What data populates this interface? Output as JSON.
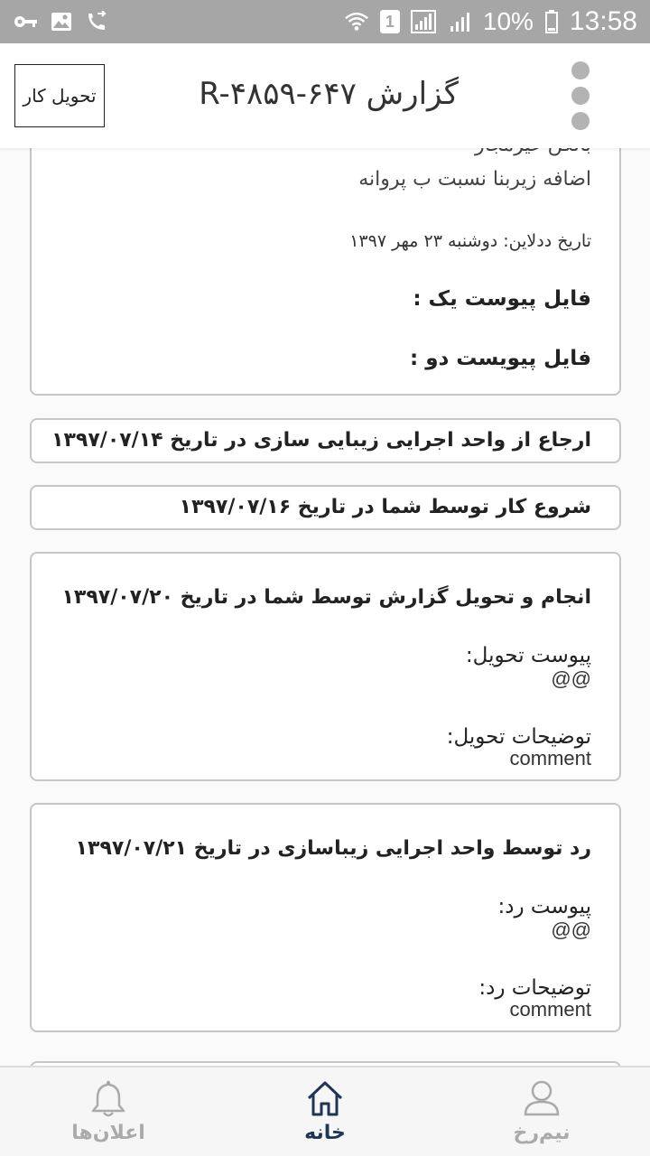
{
  "status_bar": {
    "battery_percent": "10%",
    "time": "13:58",
    "sim_number": "1"
  },
  "app_bar": {
    "title": "گزارش R-۴۸۵۹-۶۴۷",
    "deliver_button": "تحویل کار"
  },
  "details_card": {
    "line_cut": "بالکن غیرمجاز",
    "line_area": "اضافه زیربنا نسبت ب پروانه",
    "deadline": "تاریخ ددلاین: دوشنبه ۲۳ مهر ۱۳۹۷",
    "attachment_one": "فایل پیوست یک :",
    "attachment_two": "فایل پیویست دو :"
  },
  "timeline": {
    "referral": "ارجاع از واحد اجرایی زیبایی سازی در تاریخ ۱۳۹۷/۰۷/۱۴",
    "start": "شروع کار توسط شما در تاریخ ۱۳۹۷/۰۷/۱۶",
    "delivery": {
      "title": "انجام و تحویل گزارش توسط شما در تاریخ ۱۳۹۷/۰۷/۲۰",
      "attachment_label": "پیوست تحویل:",
      "attachment_value": "@@",
      "notes_label": "توضیحات تحویل:",
      "notes_value": "comment"
    },
    "rejection": {
      "title": "رد توسط واحد اجرایی زیباسازی در تاریخ ۱۳۹۷/۰۷/۲۱",
      "attachment_label": "پیوست رد:",
      "attachment_value": "@@",
      "notes_label": "توضیحات رد:",
      "notes_value": "comment"
    }
  },
  "bottom_nav": {
    "profile": "نیم‌رخ",
    "home": "خانه",
    "notifications": "اعلان‌ها"
  },
  "colors": {
    "status_bar": "#a6a6a6",
    "nav_active": "#1e3556",
    "nav_inactive": "#aaaaaa",
    "card_border": "#c6c6c6"
  }
}
